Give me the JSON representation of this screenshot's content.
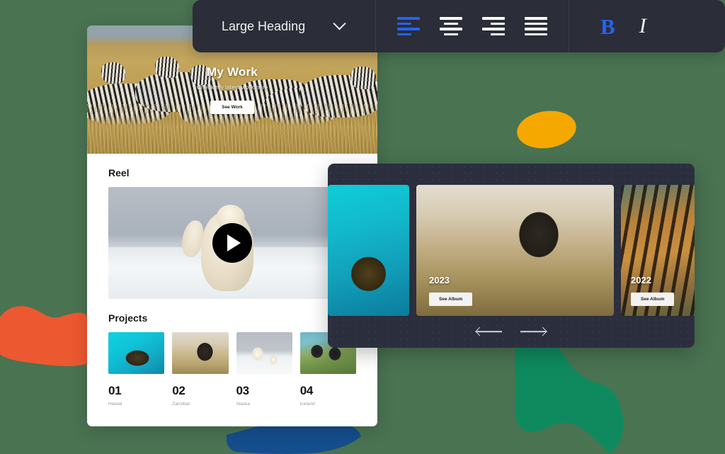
{
  "colors": {
    "background": "#4a7352",
    "blob_orange": "#ec5830",
    "blob_amber": "#f5a800",
    "blob_green": "#0f8a5f",
    "blob_blue": "#154e8c",
    "toolbar_bg": "#2b2d38",
    "panel_bg": "#2b2f3d",
    "accent_blue": "#2563f0"
  },
  "toolbar": {
    "heading_select": {
      "value": "Large Heading",
      "chevron_icon": "chevron-down-icon"
    },
    "align_buttons": [
      {
        "name": "align-left",
        "label": "Align left",
        "active": true
      },
      {
        "name": "align-center",
        "label": "Align center",
        "active": false
      },
      {
        "name": "align-right",
        "label": "Align right",
        "active": false
      },
      {
        "name": "align-justify",
        "label": "Justify",
        "active": false
      }
    ],
    "bold_label": "B",
    "bold_active": true,
    "italic_label": "I",
    "italic_active": false
  },
  "website_card": {
    "hero": {
      "title": "My Work",
      "subtitle": "Check my latest work here",
      "button_label": "See Work",
      "image_alt": "zebras-in-savanna-grass"
    },
    "reel": {
      "section_title": "Reel",
      "play_icon": "play-icon",
      "image_alt": "polar-bear-waving-on-ice"
    },
    "projects": {
      "section_title": "Projects",
      "items": [
        {
          "number": "01",
          "caption": "Hawaii",
          "image_alt": "sea-turtle-in-turquoise-water"
        },
        {
          "number": "02",
          "caption": "Zanzibar",
          "image_alt": "elephant-in-dry-grassland"
        },
        {
          "number": "03",
          "caption": "Alaska",
          "image_alt": "polar-bear-and-cub-on-snow"
        },
        {
          "number": "04",
          "caption": "Iceland",
          "image_alt": "puffins-on-mossy-cliff"
        }
      ]
    }
  },
  "gallery_panel": {
    "slides": [
      {
        "year": "",
        "button_label": "",
        "image_alt": "sea-turtle-underwater"
      },
      {
        "year": "2023",
        "button_label": "See Album",
        "image_alt": "elephant-walking-in-savanna"
      },
      {
        "year": "2022",
        "button_label": "See Album",
        "image_alt": "tiger-in-tall-grass"
      }
    ],
    "nav": {
      "prev_icon": "arrow-left-icon",
      "next_icon": "arrow-right-icon"
    }
  }
}
